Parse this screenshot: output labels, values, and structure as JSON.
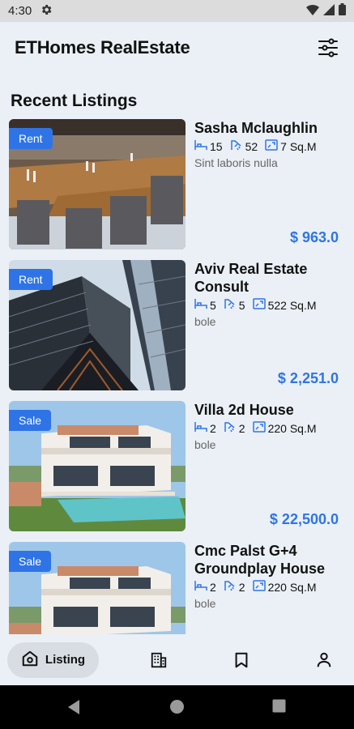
{
  "status_bar": {
    "time": "4:30"
  },
  "app": {
    "title": "ETHomes RealEstate"
  },
  "section": {
    "title": "Recent Listings"
  },
  "listings": [
    {
      "tag": "Rent",
      "name": "Sasha Mclaughlin",
      "beds": "15",
      "baths": "52",
      "area": "7 Sq.M",
      "location": "Sint laboris nulla",
      "price": "$ 963.0",
      "image": "restaurant"
    },
    {
      "tag": "Rent",
      "name": "Aviv Real Estate Consult",
      "beds": "5",
      "baths": "5",
      "area": "522 Sq.M",
      "location": "bole",
      "price": "$ 2,251.0",
      "image": "skyscrapers"
    },
    {
      "tag": "Sale",
      "name": "Villa 2d House",
      "beds": "2",
      "baths": "2",
      "area": "220 Sq.M",
      "location": "bole",
      "price": "$ 22,500.0",
      "image": "villa"
    },
    {
      "tag": "Sale",
      "name": "Cmc Palst G+4 Groundplay House",
      "beds": "2",
      "baths": "2",
      "area": "220 Sq.M",
      "location": "bole",
      "price": "",
      "image": "villa"
    }
  ],
  "bottom_nav": {
    "active_label": "Listing",
    "items": [
      "home-icon",
      "building-icon",
      "bookmark-icon",
      "person-icon"
    ]
  },
  "colors": {
    "accent": "#2f74e6",
    "background": "#eaf0f6"
  }
}
